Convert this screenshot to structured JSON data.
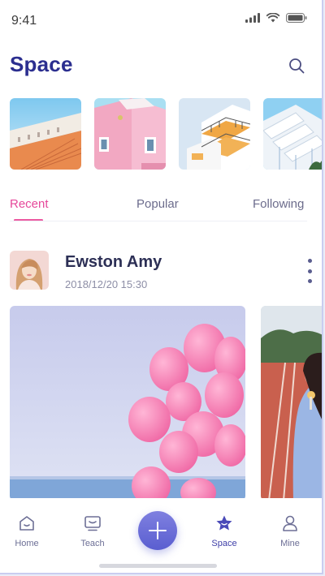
{
  "status_bar": {
    "time": "9:41"
  },
  "header": {
    "title": "Space",
    "search_icon": "search-icon"
  },
  "stories": [
    {
      "name": "story-staircase"
    },
    {
      "name": "story-pink-building"
    },
    {
      "name": "story-white-balconies"
    },
    {
      "name": "story-white-facade"
    }
  ],
  "tabs": [
    {
      "label": "Recent",
      "active": true
    },
    {
      "label": "Popular",
      "active": false
    },
    {
      "label": "Following",
      "active": false
    }
  ],
  "post": {
    "author": "Ewston Amy",
    "timestamp": "2018/12/20 15:30"
  },
  "nav": {
    "items": [
      {
        "label": "Home",
        "icon": "home-icon",
        "active": false
      },
      {
        "label": "Teach",
        "icon": "teach-icon",
        "active": false
      },
      {
        "label": "Space",
        "icon": "star-icon",
        "active": true
      },
      {
        "label": "Mine",
        "icon": "user-icon",
        "active": false
      }
    ],
    "fab_icon": "plus-icon"
  },
  "colors": {
    "accent": "#2b2e8f",
    "active_tab": "#e6479a",
    "fab": "#6b6ed8"
  }
}
